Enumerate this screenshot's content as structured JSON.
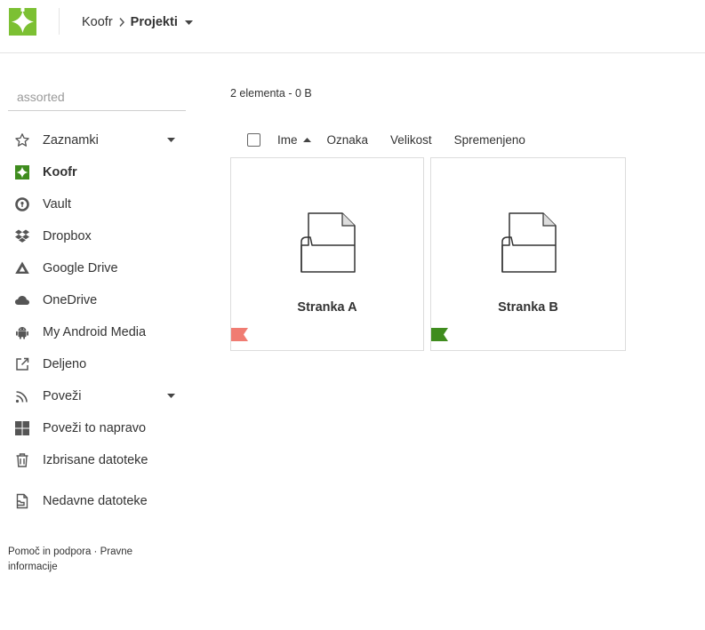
{
  "header": {
    "breadcrumb_root": "Koofr",
    "breadcrumb_current": "Projekti",
    "logo_color": "#7cc033"
  },
  "search": {
    "placeholder": "assorted"
  },
  "sidebar": {
    "items": [
      {
        "label": "Zaznamki",
        "icon": "star-icon",
        "has_caret": true
      },
      {
        "label": "Koofr",
        "icon": "koofr-logo-icon",
        "active": true
      },
      {
        "label": "Vault",
        "icon": "vault-icon"
      },
      {
        "label": "Dropbox",
        "icon": "dropbox-icon"
      },
      {
        "label": "Google Drive",
        "icon": "google-drive-icon"
      },
      {
        "label": "OneDrive",
        "icon": "cloud-icon"
      },
      {
        "label": "My Android Media",
        "icon": "android-icon"
      },
      {
        "label": "Deljeno",
        "icon": "external-link-icon"
      },
      {
        "label": "Poveži",
        "icon": "rss-icon",
        "has_caret": true
      },
      {
        "label": "Poveži to napravo",
        "icon": "windows-icon"
      },
      {
        "label": "Izbrisane datoteke",
        "icon": "trash-icon"
      },
      {
        "label": "Nedavne datoteke",
        "icon": "recent-files-icon"
      }
    ]
  },
  "footer": {
    "help_link": "Pomoč in podpora",
    "separator": "·",
    "legal_link": "Pravne informacije"
  },
  "main": {
    "summary": "2 elementa - 0 B",
    "sort_columns": {
      "name": "Ime",
      "tag": "Oznaka",
      "size": "Velikost",
      "modified": "Spremenjeno"
    },
    "items": [
      {
        "name": "Stranka A",
        "icon": "folder-file-icon",
        "tag_color": "#f07c72"
      },
      {
        "name": "Stranka B",
        "icon": "folder-file-icon",
        "tag_color": "#3f8c1e"
      }
    ]
  }
}
